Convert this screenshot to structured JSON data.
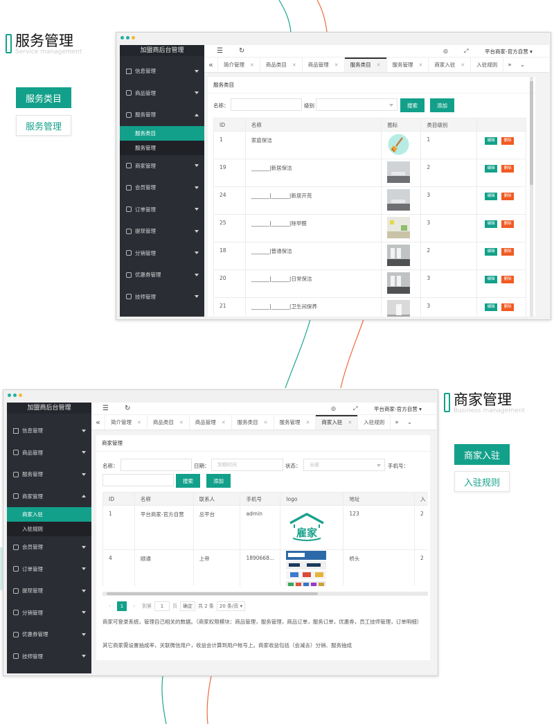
{
  "section1": {
    "title": "服务管理",
    "subtitle": "Service management",
    "tags": [
      "服务类目",
      "服务管理"
    ]
  },
  "section2": {
    "title": "商家管理",
    "subtitle": "Business management",
    "tags": [
      "商家入驻",
      "入驻规则"
    ]
  },
  "colors": {
    "accent": "#13a08a",
    "danger": "#f15a22",
    "sidebar": "#2a2d34",
    "line_teal": "#1aa58e",
    "line_orange": "#ee6a3a"
  },
  "shot1": {
    "logo": "加盟商后台管理",
    "user": "平台商家-官方自营",
    "sidebar": [
      {
        "label": "信息管理",
        "icon": "home-icon"
      },
      {
        "label": "商品管理",
        "icon": "gear-icon"
      },
      {
        "label": "服务管理",
        "icon": "gear-icon",
        "open": true,
        "children": [
          "服务类目",
          "服务管理"
        ]
      },
      {
        "label": "商家管理",
        "icon": "gear-icon"
      },
      {
        "label": "会员管理",
        "icon": "gear-icon"
      },
      {
        "label": "订单管理",
        "icon": "gear-icon"
      },
      {
        "label": "提现管理",
        "icon": "gear-icon"
      },
      {
        "label": "分销管理",
        "icon": "gear-icon"
      },
      {
        "label": "优惠券管理",
        "icon": "gear-icon"
      },
      {
        "label": "技师管理",
        "icon": "gear-icon"
      }
    ],
    "tabs": [
      "简介管理",
      "商品类目",
      "商品管理",
      "服务类目",
      "服务管理",
      "商家入驻",
      "入驻规则"
    ],
    "active_tab": "服务类目",
    "panel_title": "服务类目",
    "form": {
      "name_label": "名称：",
      "level_label": "级别",
      "search": "搜索",
      "add": "添加"
    },
    "columns": [
      "ID",
      "名称",
      "图标",
      "类目级别",
      ""
    ],
    "rows": [
      {
        "id": "1",
        "name": "家庭保洁",
        "level": "1",
        "icon": "broom"
      },
      {
        "id": "19",
        "name": "_______|新居保洁",
        "level": "2",
        "icon": "room1"
      },
      {
        "id": "24",
        "name": "_______|_______|新居开荒",
        "level": "3",
        "icon": "room1"
      },
      {
        "id": "25",
        "name": "_______|_______|除甲醛",
        "level": "3",
        "icon": "room2"
      },
      {
        "id": "18",
        "name": "_______|普通保洁",
        "level": "2",
        "icon": "room3"
      },
      {
        "id": "20",
        "name": "_______|_______|日常保洁",
        "level": "3",
        "icon": "room3"
      },
      {
        "id": "21",
        "name": "_______|_______|卫生间保养",
        "level": "3",
        "icon": "room4"
      }
    ],
    "edit": "编辑",
    "del": "删除"
  },
  "shot2": {
    "logo": "加盟商后台管理",
    "user": "平台商家-官方自营",
    "sidebar": [
      {
        "label": "信息管理",
        "icon": "home-icon"
      },
      {
        "label": "商品管理",
        "icon": "gear-icon"
      },
      {
        "label": "服务管理",
        "icon": "gear-icon"
      },
      {
        "label": "商家管理",
        "icon": "gear-icon",
        "open": true,
        "children": [
          "商家入驻",
          "入驻规则"
        ]
      },
      {
        "label": "会员管理",
        "icon": "gear-icon"
      },
      {
        "label": "订单管理",
        "icon": "gear-icon"
      },
      {
        "label": "提现管理",
        "icon": "gear-icon"
      },
      {
        "label": "分销管理",
        "icon": "gear-icon"
      },
      {
        "label": "优惠券管理",
        "icon": "gear-icon"
      },
      {
        "label": "技师管理",
        "icon": "gear-icon"
      }
    ],
    "tabs": [
      "简介管理",
      "商品类目",
      "商品管理",
      "服务类目",
      "服务管理",
      "商家入驻",
      "入驻规则"
    ],
    "active_tab": "商家入驻",
    "panel_title": "商家管理",
    "form": {
      "name_label": "名称：",
      "date_label": "日期：",
      "date_placeholder": "到期时间",
      "status_label": "状态：",
      "status_value": "全部",
      "phone_label": "手机号：",
      "search": "搜索",
      "add": "添加"
    },
    "columns": [
      "ID",
      "名称",
      "联系人",
      "手机号",
      "logo",
      "地址",
      "入"
    ],
    "rows": [
      {
        "id": "1",
        "name": "平台商家-官方自营",
        "contact": "总平台",
        "phone": "admin",
        "logo": "yujia",
        "addr": "123",
        "extra": "2"
      },
      {
        "id": "4",
        "name": "顺通",
        "contact": "上帝",
        "phone": "1890668...",
        "logo": "screens",
        "addr": "桥头",
        "extra": "2"
      }
    ],
    "logo_text": "雇家",
    "pager": {
      "current": "1",
      "goto": "到第",
      "page_input": "1",
      "page_unit": "页",
      "confirm": "确定",
      "total": "共 2 条",
      "per_page": "20 条/页"
    },
    "notes": [
      "商家可登录系统，管理自己相关的数据。（商家权限模块：商品管理，服务管理，商品订单，服务订单，优惠券，员工技师管理，订单明细）",
      "其它商家需设置抽成率，关联微信用户，收益会计算到用户帐号上。商家收益包括（会减去）分销、服务抽成"
    ]
  }
}
